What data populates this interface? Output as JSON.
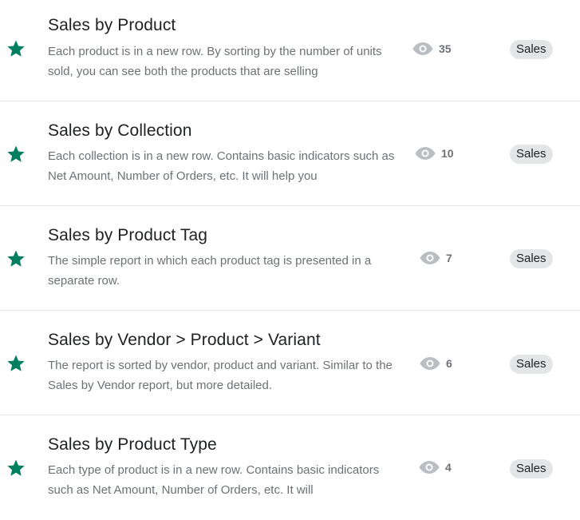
{
  "theme": {
    "star_color": "#008060",
    "eye_color": "#babec3",
    "tag_bg": "#e4e5e7"
  },
  "reports": [
    {
      "title": "Sales by Product",
      "description": "Each product is in a new row. By sorting by the number of units sold, you can see both the products that are selling",
      "views": "35",
      "tag": "Sales",
      "favorite": true
    },
    {
      "title": "Sales by Collection",
      "description": "Each collection is in a new row. Contains basic indicators such as Net Amount, Number of Orders, etc. It will help you",
      "views": "10",
      "tag": "Sales",
      "favorite": true
    },
    {
      "title": "Sales by Product Tag",
      "description": "The simple report in which each product tag is presented in a separate row.",
      "views": "7",
      "tag": "Sales",
      "favorite": true
    },
    {
      "title": "Sales by Vendor > Product > Variant",
      "description": "The report is sorted by vendor, product and variant. Similar to the Sales by Vendor report, but more detailed.",
      "views": "6",
      "tag": "Sales",
      "favorite": true
    },
    {
      "title": "Sales by Product Type",
      "description": "Each type of product is in a new row. Contains basic indicators such as Net Amount, Number of Orders, etc. It will",
      "views": "4",
      "tag": "Sales",
      "favorite": true
    }
  ]
}
